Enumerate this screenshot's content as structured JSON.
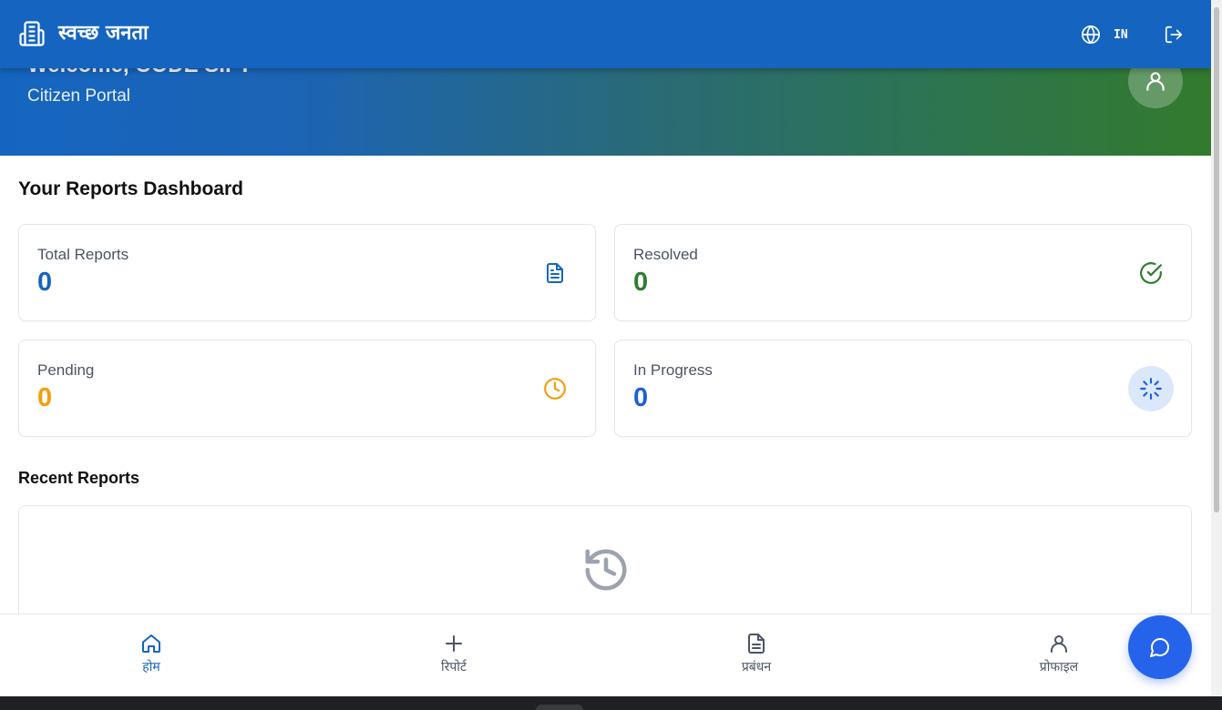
{
  "header": {
    "brand_title": "स्वच्छ जनता",
    "language_code": "IN"
  },
  "hero": {
    "welcome": "Welcome, CODE SIFT",
    "subtitle": "Citizen Portal"
  },
  "dashboard": {
    "title": "Your Reports Dashboard",
    "cards": [
      {
        "label": "Total Reports",
        "value": "0",
        "color": "#1565c0",
        "icon": "document-icon"
      },
      {
        "label": "Resolved",
        "value": "0",
        "color": "#2e7d32",
        "icon": "check-circle-icon"
      },
      {
        "label": "Pending",
        "value": "0",
        "color": "#f59e0b",
        "icon": "clock-icon"
      },
      {
        "label": "In Progress",
        "value": "0",
        "color": "#1d5fd6",
        "icon": "loader-icon"
      }
    ]
  },
  "recent": {
    "title": "Recent Reports",
    "icon": "history-icon"
  },
  "bottom_nav": {
    "items": [
      {
        "label": "होम",
        "icon": "home-icon",
        "active": true
      },
      {
        "label": "रिपोर्ट",
        "icon": "plus-icon",
        "active": false
      },
      {
        "label": "प्रबंधन",
        "icon": "document-icon",
        "active": false
      },
      {
        "label": "प्रोफाइल",
        "icon": "user-icon",
        "active": false
      }
    ]
  },
  "fab": {
    "icon": "chat-icon"
  },
  "colors": {
    "primary": "#1565c0",
    "gradient_end": "#337a2d",
    "resolved": "#2e7d32",
    "pending": "#f59e0b",
    "progress": "#1d5fd6",
    "fab": "#2563eb"
  }
}
